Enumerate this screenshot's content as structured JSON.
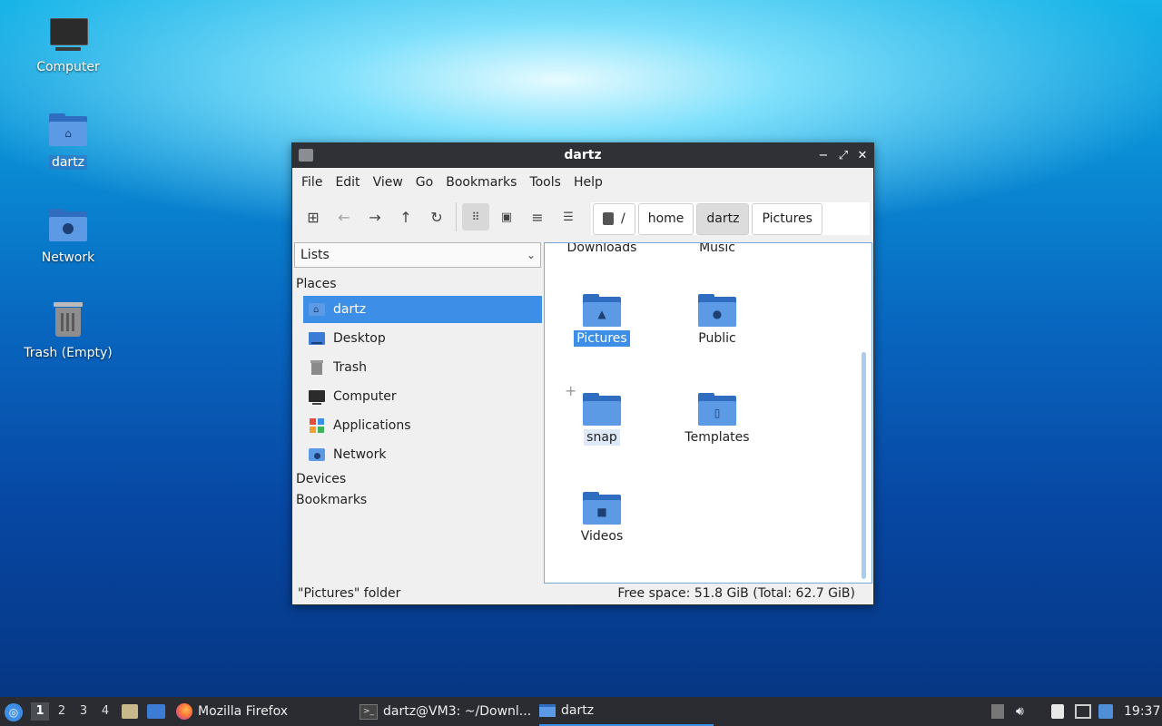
{
  "desktop": {
    "icons": [
      {
        "label": "Computer"
      },
      {
        "label": "dartz"
      },
      {
        "label": "Network"
      },
      {
        "label": "Trash (Empty)"
      }
    ]
  },
  "window": {
    "title": "dartz",
    "menu": [
      "File",
      "Edit",
      "View",
      "Go",
      "Bookmarks",
      "Tools",
      "Help"
    ],
    "path": {
      "root": "/",
      "crumbs": [
        "home",
        "dartz",
        "Pictures"
      ]
    },
    "sidebar": {
      "dropdown_value": "Lists",
      "places_header": "Places",
      "places": [
        "dartz",
        "Desktop",
        "Trash",
        "Computer",
        "Applications",
        "Network"
      ],
      "devices_header": "Devices",
      "bookmarks_header": "Bookmarks"
    },
    "files": {
      "partial_top": [
        "Downloads",
        "Music"
      ],
      "items": [
        "Pictures",
        "Public",
        "snap",
        "Templates",
        "Videos"
      ]
    },
    "status": {
      "left": "\"Pictures\" folder",
      "right": "Free space: 51.8 GiB (Total: 62.7 GiB)"
    }
  },
  "taskbar": {
    "workspaces": [
      "1",
      "2",
      "3",
      "4"
    ],
    "tasks": [
      "Mozilla Firefox",
      "dartz@VM3: ~/Downl...",
      "dartz"
    ],
    "clock": "19:37"
  },
  "colors": {
    "accent": "#3d8ee6",
    "folder": "#5c9ae6",
    "titlebar": "#2f3136",
    "taskbar": "#2a2c31"
  }
}
